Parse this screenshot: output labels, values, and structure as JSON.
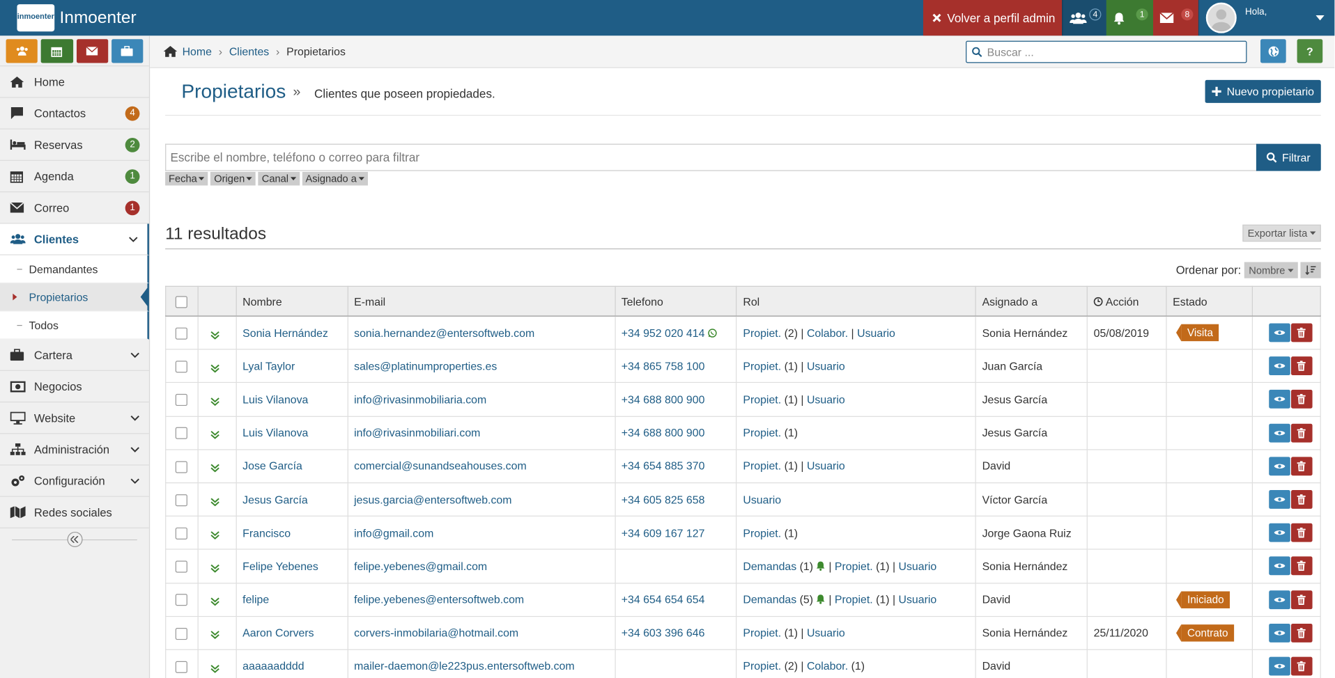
{
  "app": {
    "name": "Inmoenter",
    "logo_text": "inmoenter"
  },
  "topbar": {
    "back_label": "Volver a perfil admin",
    "users_count": "4",
    "bell_count": "1",
    "mail_count": "8",
    "greeting": "Hola,",
    "colors": {
      "bar": "#1f5d86",
      "back": "#a6302b",
      "users": "#1a4d6e",
      "bell": "#3d7a31",
      "mail": "#a6302b"
    }
  },
  "quick_buttons": [
    {
      "icon": "users-icon",
      "color": "#e08b1e"
    },
    {
      "icon": "calendar-icon",
      "color": "#3d7a31"
    },
    {
      "icon": "envelope-icon",
      "color": "#a6302b"
    },
    {
      "icon": "briefcase-icon",
      "color": "#3b87b8"
    }
  ],
  "sidebar": {
    "items": [
      {
        "label": "Home",
        "icon": "home-icon"
      },
      {
        "label": "Contactos",
        "icon": "comment-icon",
        "badge": "4",
        "badge_color": "#c26a1a"
      },
      {
        "label": "Reservas",
        "icon": "bed-icon",
        "badge": "2",
        "badge_color": "#4e8a3e"
      },
      {
        "label": "Agenda",
        "icon": "calendar-icon",
        "badge": "1",
        "badge_color": "#4e8a3e"
      },
      {
        "label": "Correo",
        "icon": "envelope-icon",
        "badge": "1",
        "badge_color": "#a6302b"
      },
      {
        "label": "Clientes",
        "icon": "users-icon"
      },
      {
        "label": "Cartera",
        "icon": "briefcase-icon"
      },
      {
        "label": "Negocios",
        "icon": "money-icon"
      },
      {
        "label": "Website",
        "icon": "desktop-icon"
      },
      {
        "label": "Administración",
        "icon": "sitemap-icon"
      },
      {
        "label": "Configuración",
        "icon": "cogs-icon"
      },
      {
        "label": "Redes sociales",
        "icon": "social-icon"
      }
    ],
    "subitems": [
      "Demandantes",
      "Propietarios",
      "Todos"
    ]
  },
  "breadcrumb": [
    "Home",
    "Clientes",
    "Propietarios"
  ],
  "search": {
    "placeholder": "Buscar ..."
  },
  "page": {
    "title": "Propietarios",
    "subtitle": "Clientes que poseen propiedades.",
    "new_button": "Nuevo propietario"
  },
  "filter": {
    "placeholder": "Escribe el nombre, teléfono o correo para filtrar",
    "button": "Filtrar",
    "chips": [
      "Fecha",
      "Origen",
      "Canal",
      "Asignado a"
    ]
  },
  "results_label": "11 resultados",
  "export_label": "Exportar lista",
  "order": {
    "label": "Ordenar por:",
    "value": "Nombre"
  },
  "table": {
    "headers": [
      "Nombre",
      "E-mail",
      "Telefono",
      "Rol",
      "Asignado a",
      "Acción",
      "Estado"
    ],
    "rows": [
      {
        "name": "Sonia Hernández",
        "email": "sonia.hernandez@entersoftweb.com",
        "phone": "+34 952 020 414",
        "whatsapp": true,
        "roles": [
          {
            "t": "Propiet.",
            "n": "(2)"
          },
          {
            "t": "Colabor.",
            "n": ""
          },
          {
            "t": "Usuario",
            "n": ""
          }
        ],
        "assigned": "Sonia Hernández",
        "action": "05/08/2019",
        "status": "Visita"
      },
      {
        "name": "Lyal Taylor",
        "email": "sales@platinumproperties.es",
        "phone": "+34 865 758 100",
        "roles": [
          {
            "t": "Propiet.",
            "n": "(1)"
          },
          {
            "t": "Usuario",
            "n": ""
          }
        ],
        "assigned": "Juan García",
        "action": "",
        "status": ""
      },
      {
        "name": "Luis Vilanova",
        "email": "info@rivasinmobiliaria.com",
        "phone": "+34 688 800 900",
        "roles": [
          {
            "t": "Propiet.",
            "n": "(1)"
          },
          {
            "t": "Usuario",
            "n": ""
          }
        ],
        "assigned": "Jesus García",
        "action": "",
        "status": ""
      },
      {
        "name": "Luis Vilanova",
        "email": "info@rivasinmobiliari.com",
        "phone": "+34 688 800 900",
        "roles": [
          {
            "t": "Propiet.",
            "n": "(1)"
          }
        ],
        "assigned": "Jesus García",
        "action": "",
        "status": ""
      },
      {
        "name": "Jose García",
        "email": "comercial@sunandseahouses.com",
        "phone": "+34 654 885 370",
        "roles": [
          {
            "t": "Propiet.",
            "n": "(1)"
          },
          {
            "t": "Usuario",
            "n": ""
          }
        ],
        "assigned": "David",
        "action": "",
        "status": ""
      },
      {
        "name": "Jesus García",
        "email": "jesus.garcia@entersoftweb.com",
        "phone": "+34 605 825 658",
        "roles": [
          {
            "t": "Usuario",
            "n": ""
          }
        ],
        "assigned": "Víctor García",
        "action": "",
        "status": ""
      },
      {
        "name": "Francisco",
        "email": "info@gmail.com",
        "phone": "+34 609 167 127",
        "roles": [
          {
            "t": "Propiet.",
            "n": "(1)"
          }
        ],
        "assigned": "Jorge Gaona Ruiz",
        "action": "",
        "status": ""
      },
      {
        "name": "Felipe Yebenes",
        "email": "felipe.yebenes@gmail.com",
        "phone": "",
        "roles": [
          {
            "t": "Demandas",
            "n": "(1)",
            "bell": true
          },
          {
            "t": "Propiet.",
            "n": "(1)"
          },
          {
            "t": "Usuario",
            "n": ""
          }
        ],
        "assigned": "Sonia Hernández",
        "action": "",
        "status": ""
      },
      {
        "name": "felipe",
        "email": "felipe.yebenes@entersoftweb.com",
        "phone": "+34 654 654 654",
        "roles": [
          {
            "t": "Demandas",
            "n": "(5)",
            "bell": true
          },
          {
            "t": "Propiet.",
            "n": "(1)"
          },
          {
            "t": "Usuario",
            "n": ""
          }
        ],
        "assigned": "David",
        "action": "",
        "status": "Iniciado"
      },
      {
        "name": "Aaron Corvers",
        "email": "corvers-inmobilaria@hotmail.com",
        "phone": "+34 603 396 646",
        "roles": [
          {
            "t": "Propiet.",
            "n": "(1)"
          },
          {
            "t": "Usuario",
            "n": ""
          }
        ],
        "assigned": "Sonia Hernández",
        "action": "25/11/2020",
        "status": "Contrato"
      },
      {
        "name": "aaaaaadddd",
        "email": "mailer-daemon@le223pus.entersoftweb.com",
        "phone": "",
        "roles": [
          {
            "t": "Propiet.",
            "n": "(2)"
          },
          {
            "t": "Colabor.",
            "n": "(1)"
          }
        ],
        "assigned": "David",
        "action": "",
        "status": ""
      }
    ]
  }
}
